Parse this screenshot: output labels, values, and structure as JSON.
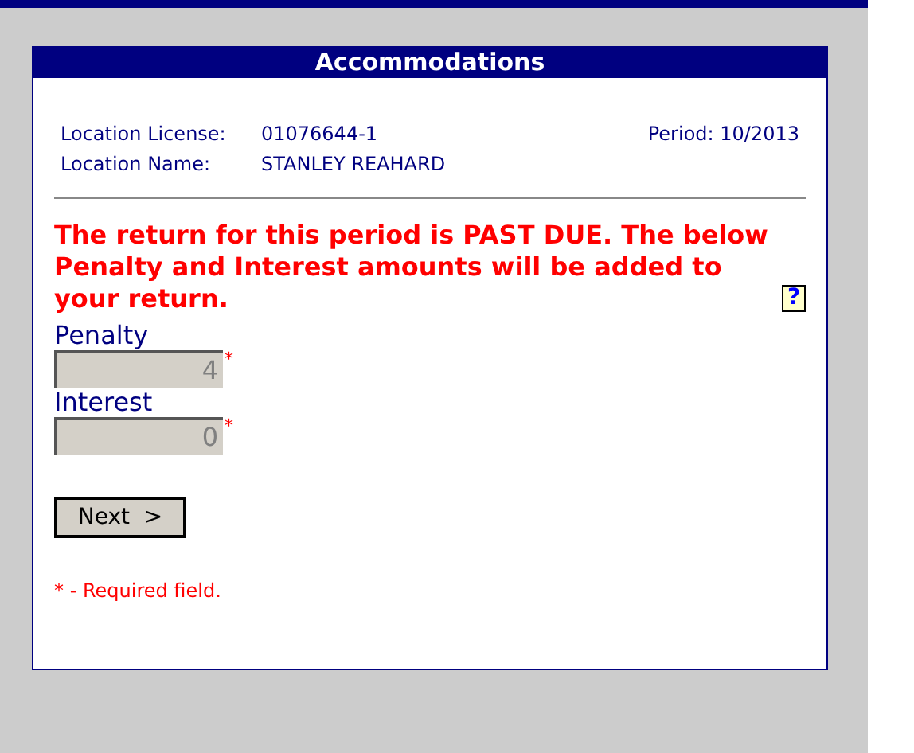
{
  "panel": {
    "title": "Accommodations"
  },
  "info": [
    {
      "label": "Location License:",
      "value": "01076644-1"
    },
    {
      "label": "Location Name:",
      "value": "STANLEY REAHARD"
    }
  ],
  "period": "Period: 10/2013",
  "warning": "The return for this period is PAST DUE. The below Penalty and Interest amounts will be added to your return.",
  "help_icon": "?",
  "fields": [
    {
      "label": "Penalty",
      "value": "4",
      "disabled": true,
      "required_mark": "*"
    },
    {
      "label": "Interest",
      "value": "0",
      "disabled": true,
      "required_mark": "*"
    }
  ],
  "next_button": "Next  >",
  "footnote": "* - Required field."
}
